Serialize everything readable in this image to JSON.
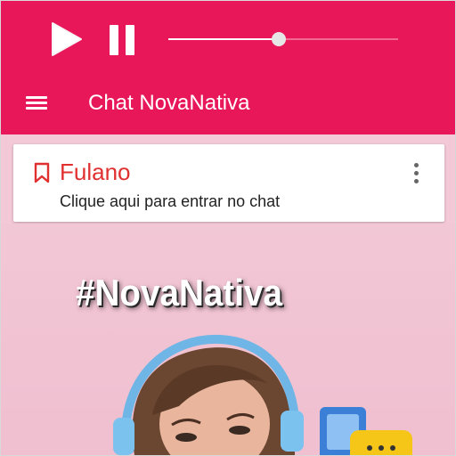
{
  "app": {
    "accent_color": "#e8175a",
    "title": "Chat NovaNativa"
  },
  "player": {
    "play_icon": "play-icon",
    "pause_icon": "pause-icon",
    "volume_level": 0.48
  },
  "card": {
    "icon": "bookmark-icon",
    "title": "Fulano",
    "subtitle": "Clique aqui para entrar no chat",
    "title_color": "#e03030"
  },
  "banner": {
    "hashtag": "#NovaNativa"
  }
}
